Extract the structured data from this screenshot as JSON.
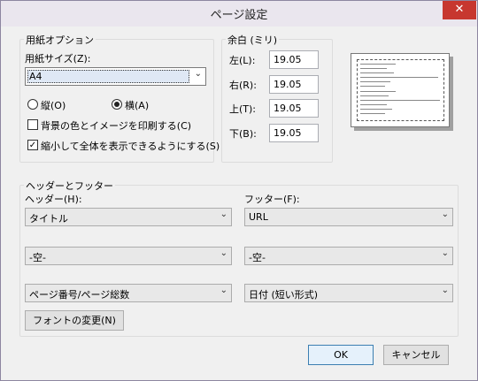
{
  "window": {
    "title": "ページ設定",
    "close_glyph": "✕"
  },
  "paper": {
    "group_label": "用紙オプション",
    "size_label": "用紙サイズ(Z):",
    "size_value": "A4",
    "portrait_label": "縦(O)",
    "landscape_label": "横(A)",
    "orientation_selected": "landscape",
    "print_bg_label": "背景の色とイメージを印刷する(C)",
    "print_bg_checked": false,
    "shrink_label": "縮小して全体を表示できるようにする(S)",
    "shrink_checked": true
  },
  "margins": {
    "group_label": "余白 (ミリ)",
    "left_label": "左(L):",
    "left_value": "19.05",
    "right_label": "右(R):",
    "right_value": "19.05",
    "top_label": "上(T):",
    "top_value": "19.05",
    "bottom_label": "下(B):",
    "bottom_value": "19.05"
  },
  "header_footer": {
    "group_label": "ヘッダーとフッター",
    "header_label": "ヘッダー(H):",
    "footer_label": "フッター(F):",
    "header_values": [
      "タイトル",
      "-空-",
      "ページ番号/ページ総数"
    ],
    "footer_values": [
      "URL",
      "-空-",
      "日付 (短い形式)"
    ],
    "font_button": "フォントの変更(N)"
  },
  "buttons": {
    "ok": "OK",
    "cancel": "キャンセル"
  },
  "icons": {
    "dropdown": "chevron-down-icon",
    "check": "checkmark-icon"
  },
  "colors": {
    "close_button": "#c7372f",
    "ok_border": "#3c7fb1"
  }
}
